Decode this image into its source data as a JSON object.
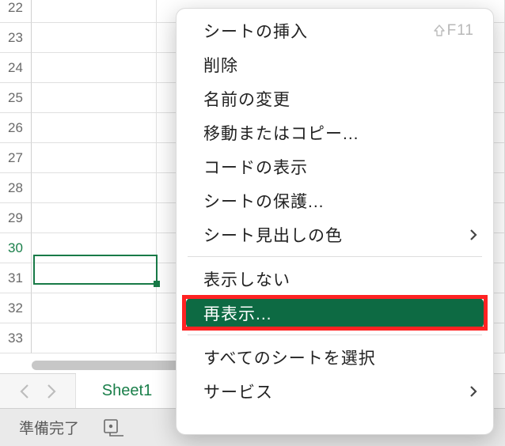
{
  "grid": {
    "first_visible_row": 22,
    "last_visible_row": 33,
    "active_row": 30,
    "rows": [
      22,
      23,
      24,
      25,
      26,
      27,
      28,
      29,
      30,
      31,
      32,
      33
    ]
  },
  "sheet_tab": {
    "label": "Sheet1"
  },
  "status": {
    "text": "準備完了"
  },
  "menu": {
    "insert_sheet": "シートの挿入",
    "insert_sheet_shortcut": "F11",
    "delete": "削除",
    "rename": "名前の変更",
    "move_copy": "移動またはコピー...",
    "view_code": "コードの表示",
    "protect_sheet": "シートの保護...",
    "tab_color": "シート見出しの色",
    "hide": "表示しない",
    "unhide": "再表示...",
    "select_all_sheets": "すべてのシートを選択",
    "services": "サービス"
  }
}
